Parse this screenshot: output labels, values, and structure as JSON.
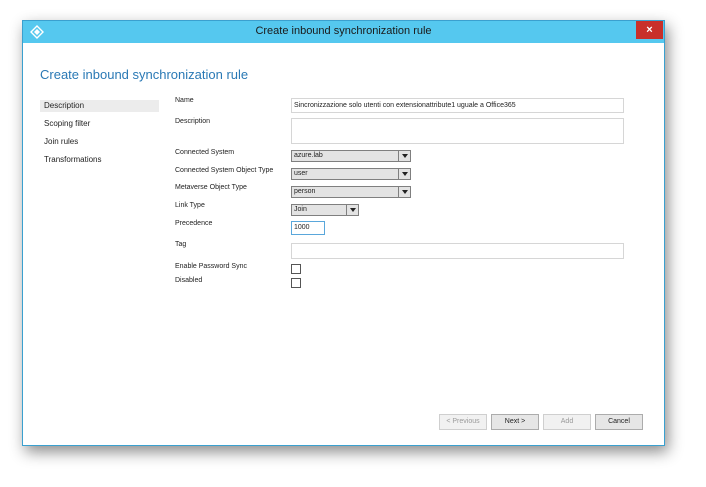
{
  "window": {
    "title": "Create inbound synchronization rule",
    "close_label": "×"
  },
  "heading": "Create inbound synchronization rule",
  "nav": [
    {
      "label": "Description",
      "selected": true
    },
    {
      "label": "Scoping filter",
      "selected": false
    },
    {
      "label": "Join rules",
      "selected": false
    },
    {
      "label": "Transformations",
      "selected": false
    }
  ],
  "form": {
    "name_label": "Name",
    "name_value": "Sincronizzazione solo utenti con extensionattribute1 uguale a Office365",
    "description_label": "Description",
    "description_value": "",
    "connected_system_label": "Connected System",
    "connected_system_value": "azure.lab",
    "connected_system_object_type_label": "Connected System Object Type",
    "connected_system_object_type_value": "user",
    "metaverse_object_type_label": "Metaverse Object Type",
    "metaverse_object_type_value": "person",
    "link_type_label": "Link Type",
    "link_type_value": "Join",
    "precedence_label": "Precedence",
    "precedence_value": "1000",
    "tag_label": "Tag",
    "tag_value": "",
    "enable_password_sync_label": "Enable Password Sync",
    "enable_password_sync_checked": false,
    "disabled_label": "Disabled",
    "disabled_checked": false
  },
  "buttons": {
    "previous": "< Previous",
    "next": "Next >",
    "add": "Add",
    "cancel": "Cancel"
  },
  "colors": {
    "titlebar": "#55c8ef",
    "heading": "#2a79b5",
    "close": "#c8302a"
  }
}
